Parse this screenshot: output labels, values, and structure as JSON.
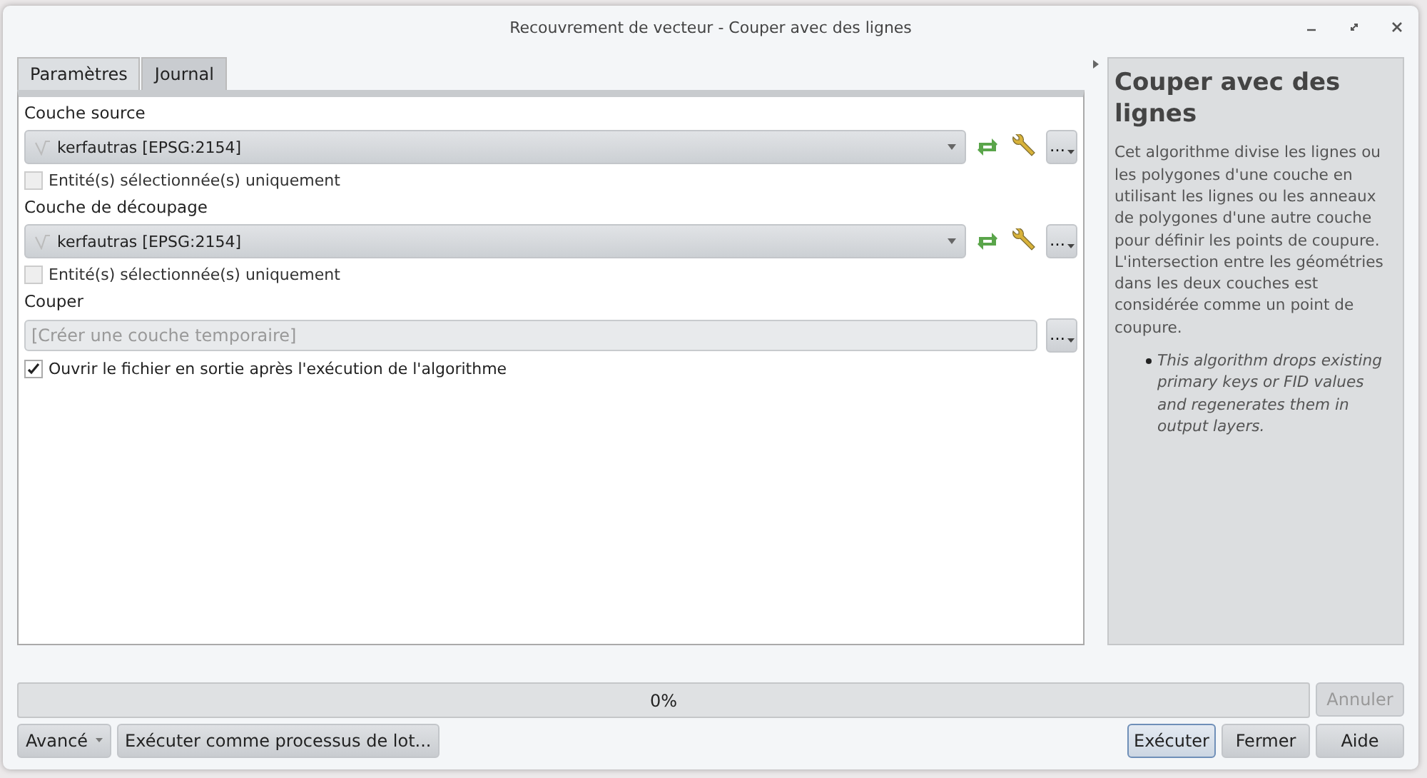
{
  "window": {
    "title": "Recouvrement de vecteur - Couper avec des lignes"
  },
  "tabs": [
    {
      "label": "Paramètres",
      "selected": true
    },
    {
      "label": "Journal",
      "selected": false
    }
  ],
  "parameters": [
    {
      "kind": "layer",
      "label": "Couche source",
      "value": "kerfautras [EPSG:2154]",
      "option": {
        "label": "Entité(s) sélectionnée(s) uniquement",
        "checked": false
      }
    },
    {
      "kind": "layer",
      "label": "Couche de découpage",
      "value": "kerfautras [EPSG:2154]",
      "option": {
        "label": "Entité(s) sélectionnée(s) uniquement",
        "checked": false
      }
    },
    {
      "kind": "output",
      "label": "Couper",
      "placeholder": "[Créer une couche temporaire]"
    },
    {
      "kind": "checkbox",
      "label": "Ouvrir le fichier en sortie après l'exécution de l'algorithme",
      "checked": true
    }
  ],
  "browse_label": "…",
  "help": {
    "title": "Couper avec des lignes",
    "text": "Cet algorithme divise les lignes ou les polygones d'une couche en utilisant les lignes ou les anneaux de polygones d'une autre couche pour définir les points de coupure. L'intersection entre les géométries dans les deux couches est considérée comme un point de coupure.",
    "notes": [
      "This algorithm drops existing primary keys or FID values and regenerates them in output layers."
    ]
  },
  "progress": {
    "level": 0,
    "text": "0%"
  },
  "cancel": {
    "label": "Annuler",
    "disabled": true
  },
  "left_buttons": [
    {
      "kind": "menu",
      "label": "Avancé"
    },
    {
      "kind": "plain",
      "label": "Exécuter comme processus de lot..."
    }
  ],
  "right_buttons": [
    {
      "label": "Exécuter",
      "default": true
    },
    {
      "label": "Fermer",
      "default": false
    },
    {
      "label": "Aide",
      "default": false
    }
  ]
}
